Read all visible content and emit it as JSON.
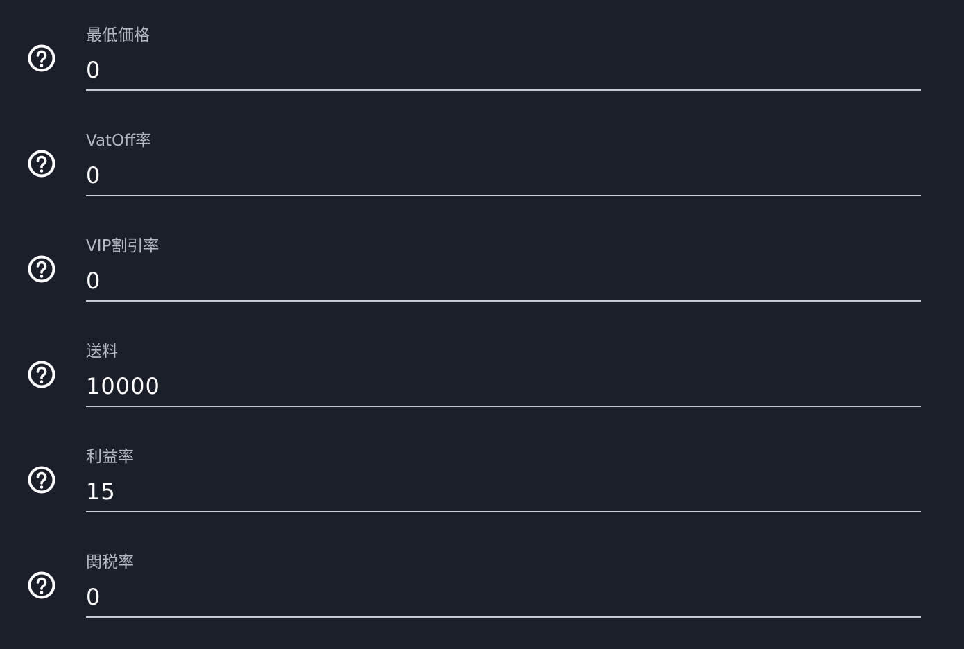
{
  "fields": [
    {
      "label": "最低価格",
      "value": "0",
      "icon": "help-circle-icon"
    },
    {
      "label": "VatOff率",
      "value": "0",
      "icon": "help-circle-icon"
    },
    {
      "label": "VIP割引率",
      "value": "0",
      "icon": "help-circle-icon"
    },
    {
      "label": "送料",
      "value": "10000",
      "icon": "help-circle-icon"
    },
    {
      "label": "利益率",
      "value": "15",
      "icon": "help-circle-icon"
    },
    {
      "label": "関税率",
      "value": "0",
      "icon": "help-circle-icon"
    }
  ],
  "colors": {
    "background": "#1a1f2a",
    "label": "#b4b8c0",
    "value": "#ffffff",
    "underline": "#c7cacf",
    "icon": "#ffffff"
  }
}
